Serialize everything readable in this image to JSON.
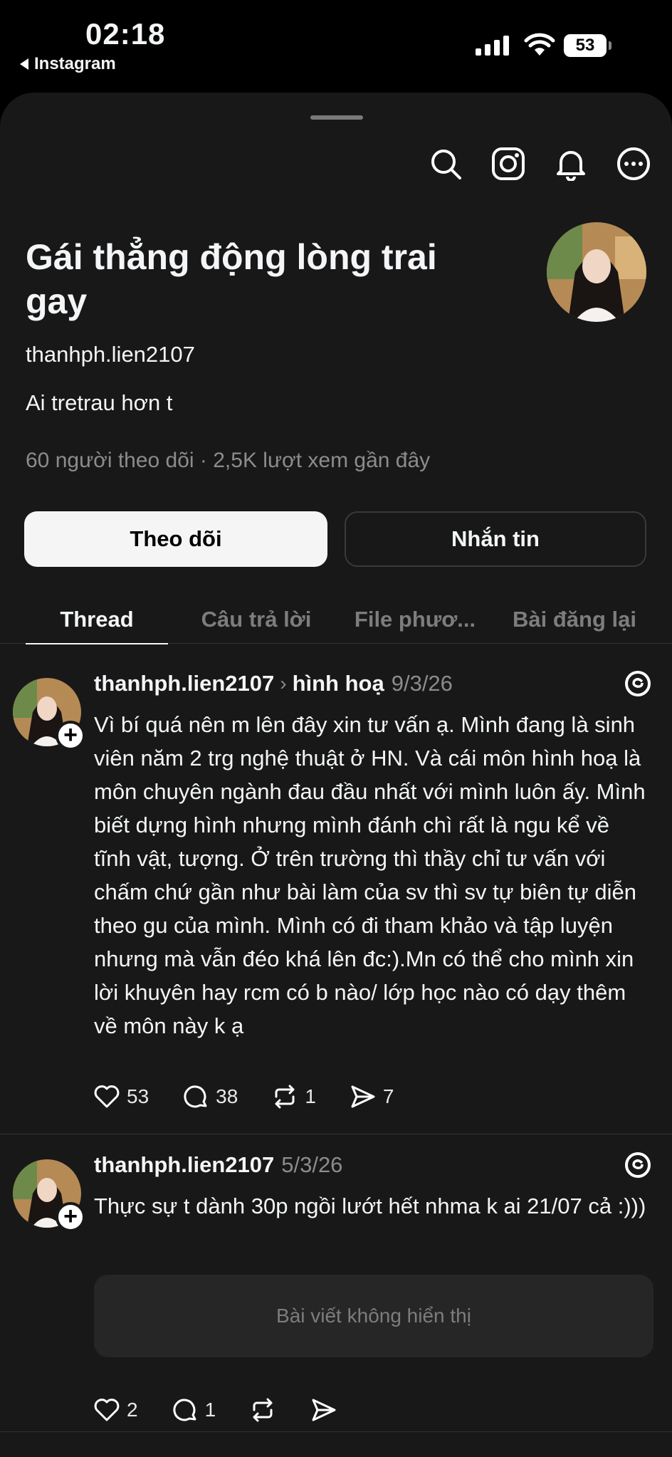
{
  "status_bar": {
    "time": "02:18",
    "back_app": "Instagram",
    "battery": "53"
  },
  "header_icons": [
    "search-icon",
    "instagram-icon",
    "bell-icon",
    "more-icon"
  ],
  "profile": {
    "display_name": "Gái thẳng động lòng trai gay",
    "handle": "thanhph.lien2107",
    "bio": "Ai tretrau hơn t",
    "stats": "60 người theo dõi · 2,5K lượt xem gần đây",
    "follow_label": "Theo dõi",
    "message_label": "Nhắn tin"
  },
  "tabs": [
    {
      "label": "Thread",
      "active": true
    },
    {
      "label": "Câu trả lời",
      "active": false
    },
    {
      "label": "File phươ...",
      "active": false
    },
    {
      "label": "Bài đăng lại",
      "active": false
    }
  ],
  "posts": [
    {
      "user": "thanhph.lien2107",
      "topic": "hình hoạ",
      "date": "9/3/26",
      "text": "Vì bí quá nên m lên đây xin tư vấn ạ. Mình đang là sinh viên năm 2 trg nghệ thuật ở HN. Và cái môn hình hoạ là môn chuyên ngành đau đầu nhất với mình luôn ấy. Mình biết dựng hình nhưng mình đánh chì rất là ngu kể về tĩnh vật, tượng. Ở trên trường thì thầy chỉ tư vấn với chấm chứ gần như bài làm của sv thì sv tự biên tự diễn theo gu của mình. Mình có đi tham khảo và tập luyện nhưng mà vẫn đéo khá lên đc:).Mn có thể cho mình xin lời khuyên hay rcm có b nào/ lớp học nào có dạy thêm về môn này k ạ",
      "likes": "53",
      "comments": "38",
      "reposts": "1",
      "shares": "7"
    },
    {
      "user": "thanhph.lien2107",
      "date": "5/3/26",
      "text": "Thực sự t dành 30p ngồi lướt hết nhma k ai 21/07 cả :)))",
      "hidden_notice": "Bài viết không hiển thị",
      "likes": "2",
      "comments": "1"
    }
  ]
}
